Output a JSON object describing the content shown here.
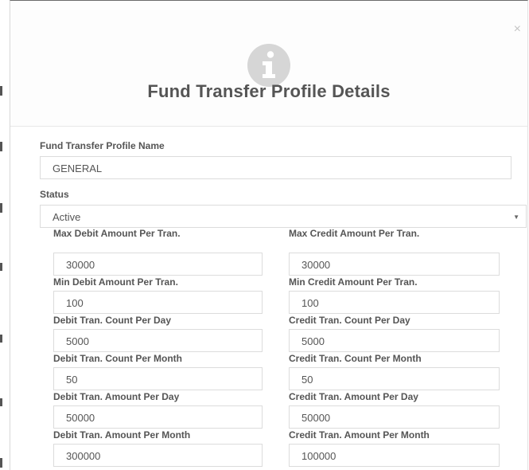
{
  "modal": {
    "title": "Fund Transfer Profile Details",
    "close_glyph": "×",
    "info_icon": "info-circle-icon"
  },
  "form": {
    "profile_name": {
      "label": "Fund Transfer Profile Name",
      "value": "GENERAL"
    },
    "status": {
      "label": "Status",
      "selected": "Active"
    },
    "limits": [
      {
        "left_label": "Max Debit Amount Per Tran.",
        "left_value": "30000",
        "right_label": "Max Credit Amount Per Tran.",
        "right_value": "30000"
      },
      {
        "left_label": "Min Debit Amount Per Tran.",
        "left_value": "100",
        "right_label": "Min Credit Amount Per Tran.",
        "right_value": "100"
      },
      {
        "left_label": "Debit Tran. Count Per Day",
        "left_value": "5000",
        "right_label": "Credit Tran. Count Per Day",
        "right_value": "5000"
      },
      {
        "left_label": "Debit Tran. Count Per Month",
        "left_value": "50",
        "right_label": "Credit Tran. Count Per Month",
        "right_value": "50"
      },
      {
        "left_label": "Debit Tran. Amount Per Day",
        "left_value": "50000",
        "right_label": "Credit Tran. Amount Per Day",
        "right_value": "50000"
      },
      {
        "left_label": "Debit Tran. Amount Per Month",
        "left_value": "300000",
        "right_label": "Credit Tran. Amount Per Month",
        "right_value": "100000"
      }
    ]
  },
  "colors": {
    "icon_gray": "#d6d6d6",
    "text": "#555555",
    "border": "#dcdcdc"
  }
}
